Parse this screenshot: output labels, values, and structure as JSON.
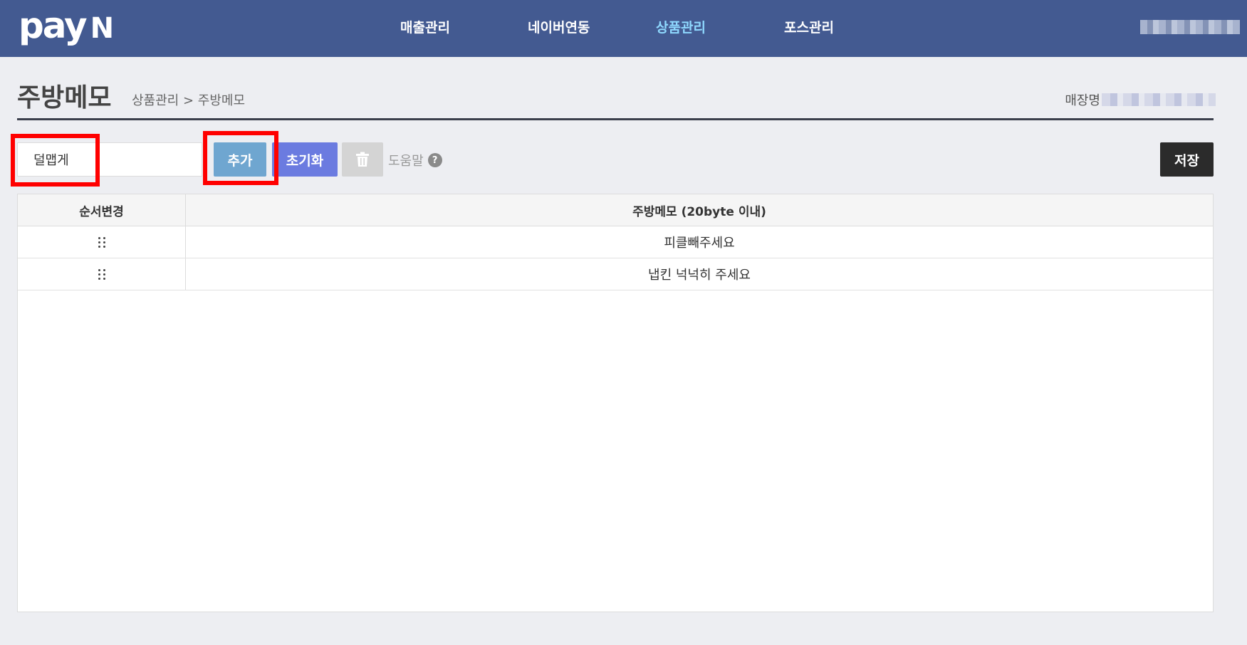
{
  "header": {
    "logo_text": "pay",
    "logo_n": "N",
    "nav": [
      {
        "label": "매출관리"
      },
      {
        "label": "네이버연동"
      },
      {
        "label": "상품관리",
        "active": true
      },
      {
        "label": "포스관리"
      }
    ]
  },
  "page": {
    "title": "주방메모",
    "breadcrumb": "상품관리 > 주방메모",
    "store_label": "매장명"
  },
  "toolbar": {
    "input_value": "덜맵게",
    "add_label": "추가",
    "reset_label": "초기화",
    "help_label": "도움말",
    "help_mark": "?",
    "save_label": "저장"
  },
  "table": {
    "headers": {
      "order": "순서변경",
      "memo": "주방메모 (20byte 이내)"
    },
    "rows": [
      {
        "memo": "피클빼주세요"
      },
      {
        "memo": "냅킨 넉넉히 주세요"
      }
    ]
  },
  "colors": {
    "header_bg": "#435a91",
    "nav_active": "#8fd9ff",
    "add_button": "#6fa6d0",
    "reset_button": "#6b7be0",
    "save_button": "#2b2b2b",
    "highlight": "#ff0000"
  }
}
